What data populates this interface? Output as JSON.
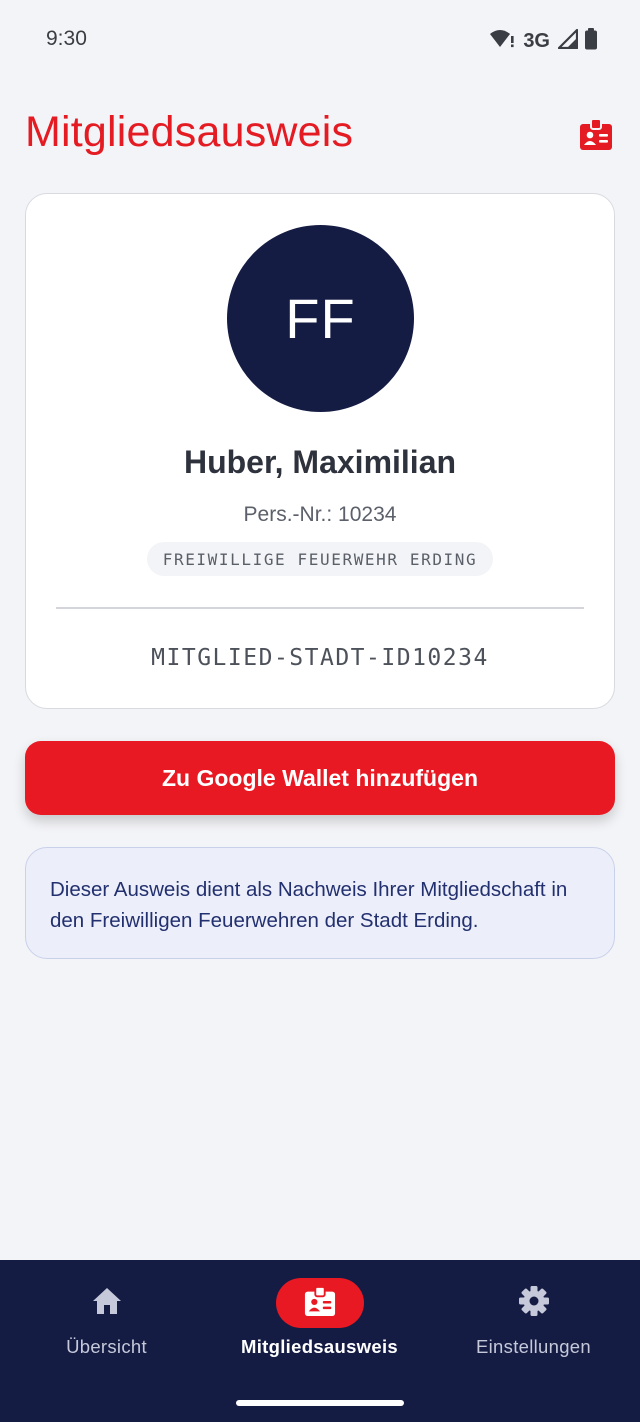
{
  "status_bar": {
    "time": "9:30",
    "network": "3G",
    "icons": [
      "wifi-alert-icon",
      "signal-icon",
      "battery-icon"
    ]
  },
  "header": {
    "title": "Mitgliedsausweis",
    "icon": "id-badge-icon"
  },
  "card": {
    "initials": "FF",
    "name": "Huber, Maximilian",
    "pers_nr": "Pers.-Nr.: 10234",
    "organization": "FREIWILLIGE FEUERWEHR ERDING",
    "member_id": "MITGLIED-STADT-ID10234"
  },
  "wallet_button": {
    "label": "Zu Google Wallet hinzufügen"
  },
  "info": {
    "text": "Dieser Ausweis dient als Nachweis Ihrer Mitgliedschaft in den Freiwilligen Feuerwehren der Stadt Erding."
  },
  "nav": {
    "items": [
      {
        "label": "Übersicht",
        "icon": "home-icon",
        "active": false
      },
      {
        "label": "Mitgliedsausweis",
        "icon": "id-badge-icon",
        "active": true
      },
      {
        "label": "Einstellungen",
        "icon": "gear-icon",
        "active": false
      }
    ]
  },
  "colors": {
    "accent": "#e81922",
    "navy": "#151c43",
    "background": "#f3f4f7",
    "info_text": "#23306f"
  }
}
